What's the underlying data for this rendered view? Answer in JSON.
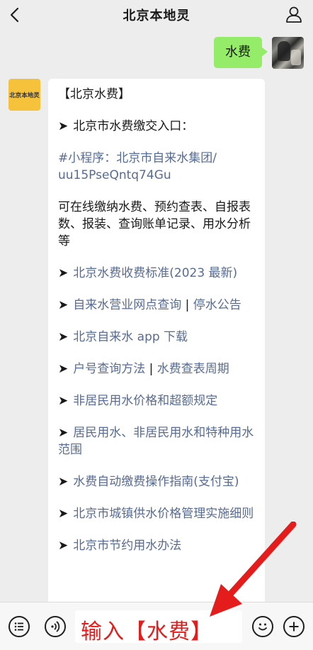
{
  "header": {
    "title": "北京本地灵"
  },
  "messages": {
    "me": {
      "text": "水费"
    },
    "bot": {
      "avatar_text": "北京本地灵",
      "heading": "【北京水费】",
      "entry_label": "北京市水费缴交入口：",
      "mini_program_line1": "#小程序：北京市自来水集团/",
      "mini_program_line2": "uu15PseQntq74Gu",
      "description": "可在线缴纳水费、预约查表、自报表数、报装、查询账单记录、用水分析等",
      "items": [
        {
          "text": "北京水费收费标准(2023 最新)"
        },
        {
          "text": "自来水营业网点查询",
          "sep": " | ",
          "text2": "停水公告"
        },
        {
          "text": "北京自来水 app 下载"
        },
        {
          "text": "户号查询方法",
          "sep": " | ",
          "text2": "水费查表周期"
        },
        {
          "text": "非居民用水价格和超额规定"
        },
        {
          "text": "居民用水、非居民用水和特种用水范围"
        },
        {
          "text": "水费自动缴费操作指南(支付宝)"
        },
        {
          "text": "北京市城镇供水价格管理实施细则"
        },
        {
          "text": "北京市节约用水办法"
        }
      ],
      "bullet": "➤"
    }
  },
  "input": {
    "value": "输入【水费】"
  },
  "colors": {
    "link": "#576b95",
    "my_bubble": "#95ec69",
    "annotation": "#e51c1c",
    "bot_avatar_bg": "#f7c23b"
  },
  "icons": {
    "back": "back-chevron-icon",
    "profile": "person-icon",
    "menu": "list-icon",
    "voice": "voice-icon",
    "emoji": "emoji-icon",
    "plus": "plus-icon"
  }
}
